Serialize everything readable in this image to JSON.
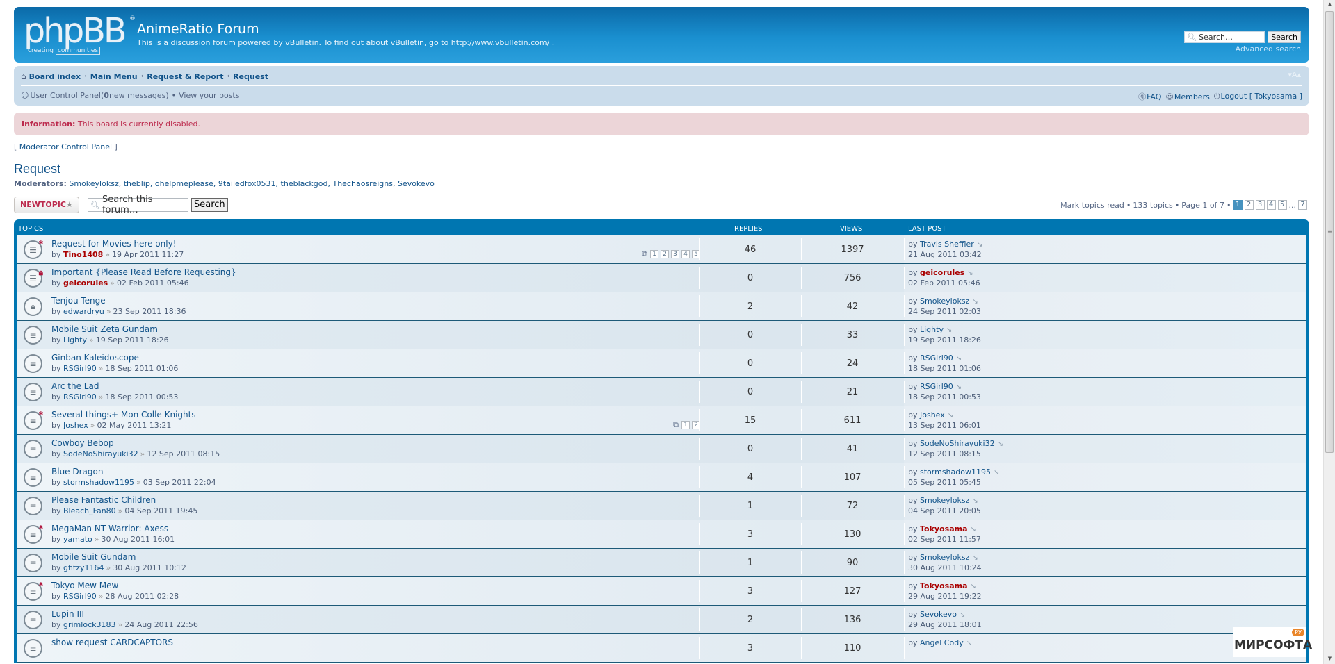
{
  "header": {
    "logo_text": "phpBB",
    "logo_tagline_left": "creating",
    "logo_tagline_right": "communities",
    "site_title": "AnimeRatio Forum",
    "site_description": "This is a discussion forum powered by vBulletin. To find out about vBulletin, go to http://www.vbulletin.com/ .",
    "search_placeholder": "Search…",
    "search_button": "Search",
    "advanced_search": "Advanced search"
  },
  "navbar": {
    "breadcrumbs": [
      "Board index",
      "Main Menu",
      "Request & Report",
      "Request"
    ],
    "font_size_control": "▾A▴",
    "ucp_label": "User Control Panel",
    "ucp_messages_open": " (",
    "ucp_messages_count": "0",
    "ucp_messages_close": " new messages)",
    "view_posts": "View your posts",
    "faq": "FAQ",
    "members": "Members",
    "logout": "Logout [ Tokyosama ]"
  },
  "info": {
    "label": "Information:",
    "message": "This board is currently disabled."
  },
  "mcp_link": "Moderator Control Panel",
  "forum": {
    "title": "Request",
    "moderators_label": "Moderators:",
    "moderators": "Smokeyloksz, theblip, ohelpmeplease, 9tailedfox0531, theblackgod, Thechaosreigns, Sevokevo"
  },
  "actions": {
    "new_topic": "NEWTOPIC",
    "forum_search_placeholder": "Search this forum…",
    "forum_search_button": "Search",
    "mark_read": "Mark topics read",
    "topic_count": "133 topics",
    "page_info": "Page 1 of 7",
    "pages": [
      "1",
      "2",
      "3",
      "4",
      "5"
    ],
    "ellipsis": "...",
    "last_page": "7",
    "current_page": "1"
  },
  "table": {
    "headers": {
      "topics": "TOPICS",
      "replies": "REPLIES",
      "views": "VIEWS",
      "last_post": "LAST POST"
    },
    "rows": [
      {
        "icon": "announcement-unread",
        "title": "Request for Movies here only!",
        "author": "Tino1408",
        "author_highlight": true,
        "date": "19 Apr 2011 11:27",
        "pages": [
          "1",
          "2",
          "3",
          "4",
          "5"
        ],
        "replies": "46",
        "views": "1397",
        "last_by": "Travis Sheffler",
        "last_highlight": false,
        "last_date": "21 Aug 2011 03:42"
      },
      {
        "icon": "announcement-locked",
        "title": "Important {Please Read Before Requesting}",
        "author": "geicorules",
        "author_highlight": true,
        "date": "02 Feb 2011 05:46",
        "pages": [],
        "replies": "0",
        "views": "756",
        "last_by": "geicorules",
        "last_highlight": true,
        "last_date": "02 Feb 2011 05:46"
      },
      {
        "icon": "topic-locked",
        "title": "Tenjou Tenge",
        "author": "edwardryu",
        "author_highlight": false,
        "date": "23 Sep 2011 18:36",
        "pages": [],
        "replies": "2",
        "views": "42",
        "last_by": "Smokeyloksz",
        "last_highlight": false,
        "last_date": "24 Sep 2011 02:03"
      },
      {
        "icon": "topic-read",
        "title": "Mobile Suit Zeta Gundam",
        "author": "Lighty",
        "author_highlight": false,
        "date": "19 Sep 2011 18:26",
        "pages": [],
        "replies": "0",
        "views": "33",
        "last_by": "Lighty",
        "last_highlight": false,
        "last_date": "19 Sep 2011 18:26"
      },
      {
        "icon": "topic-read",
        "title": "Ginban Kaleidoscope",
        "author": "RSGirl90",
        "author_highlight": false,
        "date": "18 Sep 2011 01:06",
        "pages": [],
        "replies": "0",
        "views": "24",
        "last_by": "RSGirl90",
        "last_highlight": false,
        "last_date": "18 Sep 2011 01:06"
      },
      {
        "icon": "topic-read",
        "title": "Arc the Lad",
        "author": "RSGirl90",
        "author_highlight": false,
        "date": "18 Sep 2011 00:53",
        "pages": [],
        "replies": "0",
        "views": "21",
        "last_by": "RSGirl90",
        "last_highlight": false,
        "last_date": "18 Sep 2011 00:53"
      },
      {
        "icon": "topic-unread",
        "title": "Several things+ Mon Colle Knights",
        "author": "Joshex",
        "author_highlight": false,
        "date": "02 May 2011 13:21",
        "pages": [
          "1",
          "2"
        ],
        "replies": "15",
        "views": "611",
        "last_by": "Joshex",
        "last_highlight": false,
        "last_date": "13 Sep 2011 06:01"
      },
      {
        "icon": "topic-read",
        "title": "Cowboy Bebop",
        "author": "SodeNoShirayuki32",
        "author_highlight": false,
        "date": "12 Sep 2011 08:15",
        "pages": [],
        "replies": "0",
        "views": "41",
        "last_by": "SodeNoShirayuki32",
        "last_highlight": false,
        "last_date": "12 Sep 2011 08:15"
      },
      {
        "icon": "topic-read",
        "title": "Blue Dragon",
        "author": "stormshadow1195",
        "author_highlight": false,
        "date": "03 Sep 2011 22:04",
        "pages": [],
        "replies": "4",
        "views": "107",
        "last_by": "stormshadow1195",
        "last_highlight": false,
        "last_date": "05 Sep 2011 05:45"
      },
      {
        "icon": "topic-read",
        "title": "Please Fantastic Children",
        "author": "Bleach_Fan80",
        "author_highlight": false,
        "date": "04 Sep 2011 19:45",
        "pages": [],
        "replies": "1",
        "views": "72",
        "last_by": "Smokeyloksz",
        "last_highlight": false,
        "last_date": "04 Sep 2011 20:05"
      },
      {
        "icon": "topic-unread",
        "title": "MegaMan NT Warrior: Axess",
        "author": "yamato",
        "author_highlight": false,
        "date": "30 Aug 2011 16:01",
        "pages": [],
        "replies": "3",
        "views": "130",
        "last_by": "Tokyosama",
        "last_highlight": true,
        "last_date": "02 Sep 2011 11:57"
      },
      {
        "icon": "topic-read",
        "title": "Mobile Suit Gundam",
        "author": "gfitzy1164",
        "author_highlight": false,
        "date": "30 Aug 2011 10:12",
        "pages": [],
        "replies": "1",
        "views": "90",
        "last_by": "Smokeyloksz",
        "last_highlight": false,
        "last_date": "30 Aug 2011 10:24"
      },
      {
        "icon": "topic-unread",
        "title": "Tokyo Mew Mew",
        "author": "RSGirl90",
        "author_highlight": false,
        "date": "28 Aug 2011 02:28",
        "pages": [],
        "replies": "3",
        "views": "127",
        "last_by": "Tokyosama",
        "last_highlight": true,
        "last_date": "29 Aug 2011 19:22"
      },
      {
        "icon": "topic-read",
        "title": "Lupin III",
        "author": "grimlock3183",
        "author_highlight": false,
        "date": "24 Aug 2011 22:56",
        "pages": [],
        "replies": "2",
        "views": "136",
        "last_by": "Sevokevo",
        "last_highlight": false,
        "last_date": "29 Aug 2011 18:01"
      },
      {
        "icon": "topic-read",
        "title": "show request CARDCAPTORS",
        "author": "",
        "author_highlight": false,
        "date": "",
        "pages": [],
        "replies": "3",
        "views": "110",
        "last_by": "Angel Cody",
        "last_highlight": false,
        "last_date": ""
      }
    ]
  },
  "labels": {
    "by": "by ",
    "date_sep": "»"
  },
  "watermark": {
    "text": "МИРСОФТА",
    "badge": "РУ"
  },
  "colors": {
    "header_blue": "#0b6aa8",
    "nav_bg": "#cadceb",
    "info_bg": "#ecd5d8",
    "info_text": "#bc2a4d",
    "link": "#105289",
    "highlight_user": "#aa0000",
    "table_header": "#0076b1"
  }
}
